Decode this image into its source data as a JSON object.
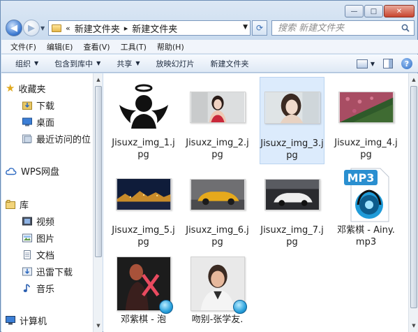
{
  "window": {
    "caption_buttons": {
      "minimize": "—",
      "maximize": "□",
      "close": "✕"
    }
  },
  "address": {
    "breadcrumb_prefix": "«",
    "crumbs": [
      "新建文件夹",
      "新建文件夹"
    ],
    "separator": "▸",
    "back_glyph": "◀",
    "forward_glyph": "▶",
    "refresh_glyph": "⟳"
  },
  "search": {
    "placeholder": "搜索 新建文件夹"
  },
  "menu": {
    "items": [
      "文件(F)",
      "编辑(E)",
      "查看(V)",
      "工具(T)",
      "帮助(H)"
    ]
  },
  "toolbar": {
    "organize": "组织",
    "include_in_library": "包含到库中",
    "share": "共享",
    "slideshow": "放映幻灯片",
    "new_folder": "新建文件夹",
    "help_glyph": "?"
  },
  "nav": {
    "favorites": "收藏夹",
    "downloads": "下载",
    "desktop": "桌面",
    "recent": "最近访问的位",
    "wps": "WPS网盘",
    "libraries": "库",
    "videos": "视频",
    "pictures": "图片",
    "documents": "文档",
    "thunder": "迅雷下载",
    "music": "音乐",
    "computer": "计算机"
  },
  "files": [
    {
      "name": "Jisuxz_img_1.jpg",
      "icon": "angel-avatar-thumbnail"
    },
    {
      "name": "Jisuxz_img_2.jpg",
      "icon": "woman-photo-thumbnail"
    },
    {
      "name": "Jisuxz_img_3.jpg",
      "icon": "woman-portrait-thumbnail",
      "selected": true
    },
    {
      "name": "Jisuxz_img_4.jpg",
      "icon": "flower-field-thumbnail"
    },
    {
      "name": "Jisuxz_img_5.jpg",
      "icon": "night-city-thumbnail"
    },
    {
      "name": "Jisuxz_img_6.jpg",
      "icon": "yellow-car-thumbnail"
    },
    {
      "name": "Jisuxz_img_7.jpg",
      "icon": "white-car-thumbnail"
    },
    {
      "name": "邓紫棋 - Ainy.mp3",
      "icon": "mp3-file-icon"
    },
    {
      "name": "邓紫棋 - 泡",
      "icon": "album-art-thumbnail"
    },
    {
      "name": "吻别-张学友.",
      "icon": "album-art-thumbnail"
    }
  ],
  "mp3_label": "MP3",
  "colors": {
    "selection": "#dcebfc",
    "frame": "#c8daee",
    "accent": "#3e7bd2"
  }
}
